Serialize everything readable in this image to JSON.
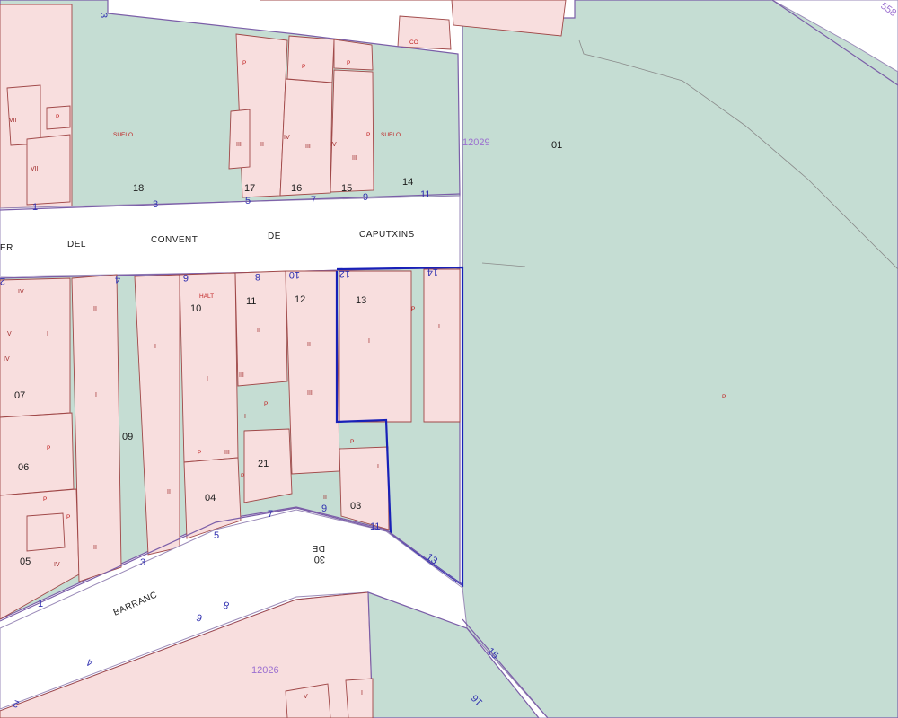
{
  "streets": {
    "convent_words": [
      "ER",
      "DEL",
      "CONVENT",
      "DE",
      "CAPUTXINS"
    ],
    "barranc": "BARRANC",
    "de_upside": "DE"
  },
  "blocks": {
    "block_a": "12029",
    "block_b": "12026",
    "block_top": "558"
  },
  "parcels_north": [
    "18",
    "17",
    "16",
    "15",
    "14",
    "01"
  ],
  "parcels_south": [
    "13",
    "12",
    "11",
    "10",
    "07",
    "06",
    "05",
    "09",
    "04",
    "21",
    "03"
  ],
  "house_numbers_north": [
    "3",
    "5",
    "7",
    "9",
    "11",
    "1",
    "3"
  ],
  "house_numbers_south": [
    "2",
    "4",
    "6",
    "8",
    "10",
    "12",
    "14"
  ],
  "house_numbers_road": [
    "1",
    "3",
    "5",
    "7",
    "9",
    "11",
    "13",
    "15",
    "16",
    "2",
    "4",
    "6",
    "8",
    "30"
  ],
  "labels": {
    "suelo": "SUELO",
    "co": "CO",
    "halt": "HALT",
    "p": "P"
  },
  "roman_floor_marks": [
    "VII",
    "VII",
    "III",
    "II",
    "IV",
    "III",
    "IV",
    "III",
    "V",
    "I",
    "IV",
    "IV",
    "II",
    "I",
    "II",
    "I",
    "I",
    "III",
    "II",
    "III",
    "II",
    "II",
    "I",
    "I",
    "I",
    "III",
    "IV",
    "II",
    "I",
    "V",
    "I"
  ],
  "colors": {
    "parcel_green": "#c5ddd3",
    "building_pink": "#f8dede",
    "block_outline": "#7b5ea8",
    "building_outline": "#a04848",
    "selected_parcel": "#1820b8",
    "house_number_blue": "#3030b0",
    "block_number_violet": "#9b6fd0"
  }
}
